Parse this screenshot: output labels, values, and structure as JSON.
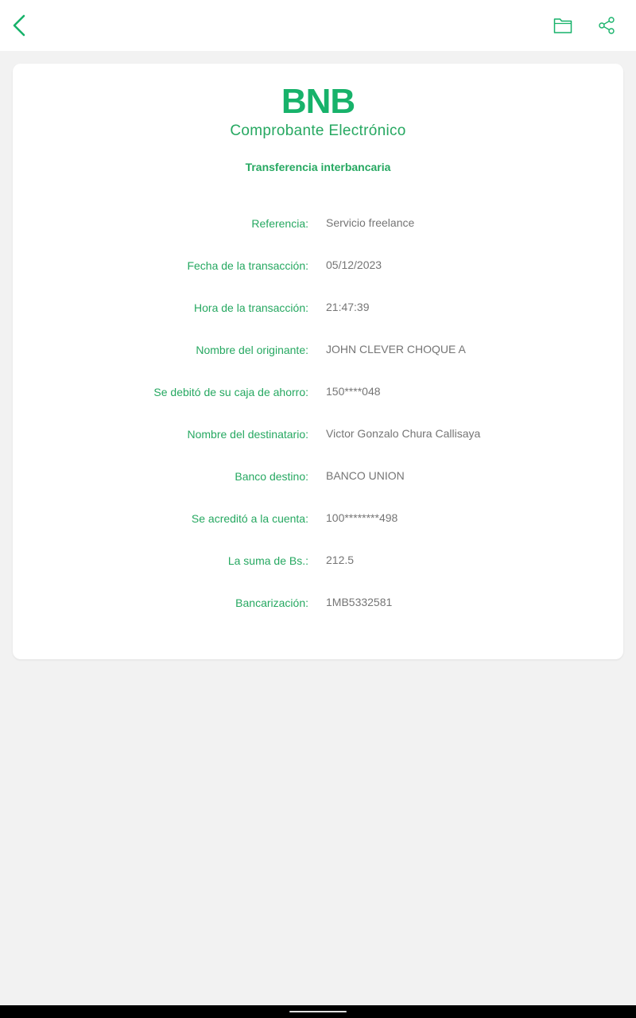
{
  "colors": {
    "accent": "#17b26a",
    "label": "#26a861",
    "value": "#757575",
    "background": "#f2f2f2"
  },
  "header": {
    "back_icon": "chevron-left-icon",
    "folder_icon": "folder-icon",
    "share_icon": "share-icon"
  },
  "receipt": {
    "logo": "BNB",
    "title": "Comprobante Electrónico",
    "type": "Transferencia interbancaria",
    "rows": [
      {
        "label": "Referencia:",
        "value": "Servicio freelance"
      },
      {
        "label": "Fecha de la transacción:",
        "value": "05/12/2023"
      },
      {
        "label": "Hora de la transacción:",
        "value": "21:47:39"
      },
      {
        "label": "Nombre del originante:",
        "value": "JOHN CLEVER CHOQUE A"
      },
      {
        "label": "Se debitó de su caja de ahorro:",
        "value": "150****048"
      },
      {
        "label": "Nombre del destinatario:",
        "value": "Victor Gonzalo Chura Callisaya"
      },
      {
        "label": "Banco destino:",
        "value": "BANCO UNION"
      },
      {
        "label": "Se acreditó a la cuenta:",
        "value": "100********498"
      },
      {
        "label": "La suma de Bs.:",
        "value": "212.5"
      },
      {
        "label": "Bancarización:",
        "value": "1MB5332581"
      }
    ]
  }
}
